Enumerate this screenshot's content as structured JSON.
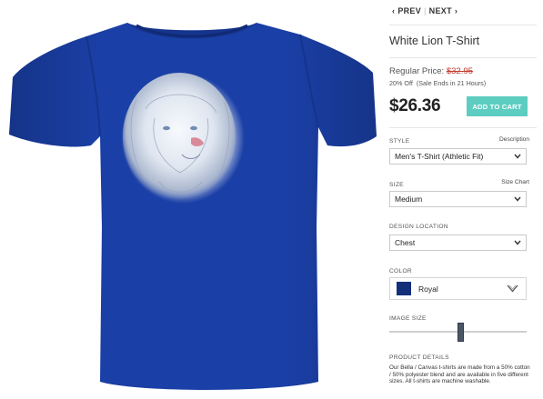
{
  "pager": {
    "prev": "PREV",
    "separator": "|",
    "next": "NEXT",
    "prev_icon": "chevron-left-icon",
    "next_icon": "chevron-right-icon"
  },
  "product": {
    "title": "White Lion T-Shirt",
    "regular_label": "Regular Price:",
    "regular_price": "$32.95",
    "discount": "20% Off",
    "sale_note": "(Sale Ends in 21 Hours)",
    "price": "$26.36",
    "add_to_cart": "ADD TO CART",
    "shirt_color": "#1a3fa6",
    "accent_color": "#5ecdc1"
  },
  "options": {
    "style": {
      "label": "STYLE",
      "link": "Description",
      "selected": "Men's T-Shirt (Athletic Fit)"
    },
    "size": {
      "label": "SIZE",
      "link": "Size Chart",
      "selected": "Medium"
    },
    "design_location": {
      "label": "DESIGN LOCATION",
      "selected": "Chest"
    },
    "color": {
      "label": "COLOR",
      "selected": "Royal",
      "swatch": "#132f7a"
    },
    "image_size": {
      "label": "IMAGE SIZE",
      "value_fraction": 0.52
    }
  },
  "details": {
    "title": "PRODUCT DETAILS",
    "text": "Our Bella / Canvas t-shirts are made from a 50% cotton / 50% polyester blend and are available in five different sizes.   All t-shirts are machine washable."
  }
}
